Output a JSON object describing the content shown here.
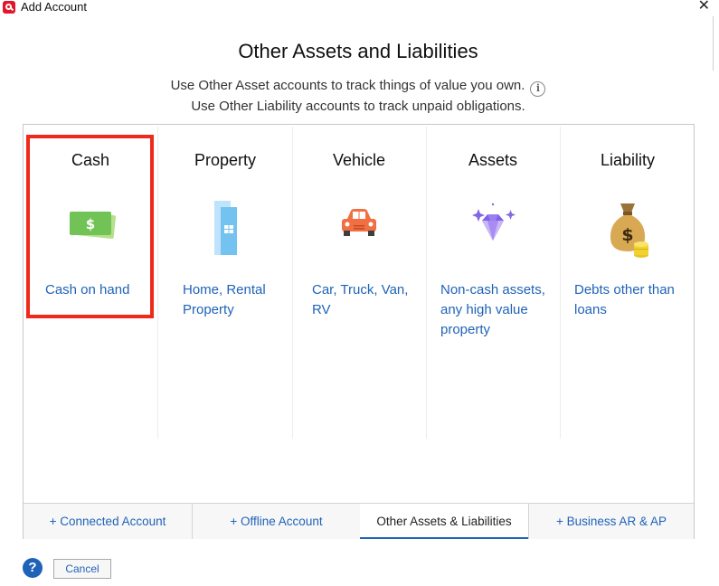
{
  "window": {
    "title": "Add Account",
    "close_label": "✕"
  },
  "header": {
    "title": "Other Assets and Liabilities",
    "line1": "Use Other Asset accounts to track things of value you own.",
    "line2": "Use Other Liability accounts to track unpaid obligations.",
    "info_label": "i"
  },
  "categories": [
    {
      "title": "Cash",
      "description": "Cash on hand",
      "icon": "cash-icon",
      "selected": true
    },
    {
      "title": "Property",
      "description": "Home, Rental Property",
      "icon": "building-icon"
    },
    {
      "title": "Vehicle",
      "description": "Car, Truck, Van, RV",
      "icon": "car-icon"
    },
    {
      "title": "Assets",
      "description": "Non-cash assets, any high value property",
      "icon": "diamond-icon"
    },
    {
      "title": "Liability",
      "description": "Debts other than loans",
      "icon": "money-bag-icon"
    }
  ],
  "tabs": [
    {
      "label": "+ Connected Account"
    },
    {
      "label": "+ Offline Account"
    },
    {
      "label": "Other Assets & Liabilities",
      "active": true
    },
    {
      "label": "+ Business AR & AP"
    }
  ],
  "footer": {
    "help_label": "?",
    "cancel_label": "Cancel"
  },
  "colors": {
    "accent": "#1f63b8",
    "highlight": "#f0291a",
    "brand": "#e0162b"
  }
}
